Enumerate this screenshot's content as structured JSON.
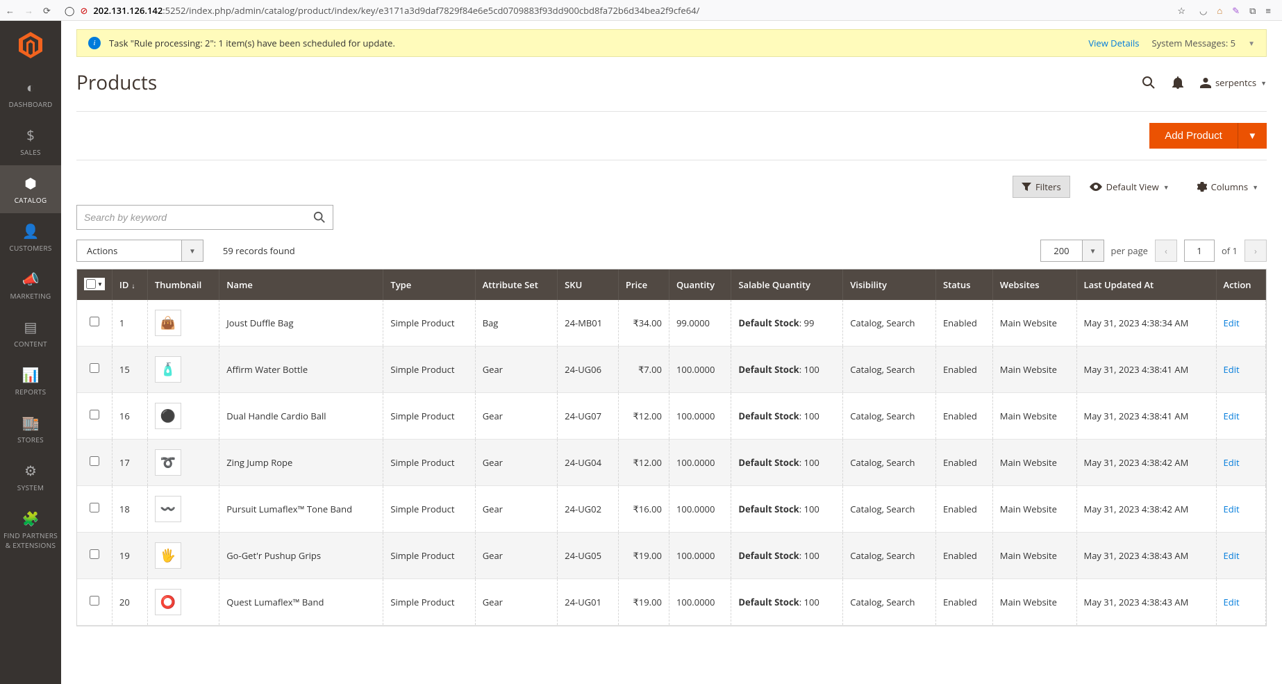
{
  "browser": {
    "url_host": "202.131.126.142",
    "url_rest": ":5252/index.php/admin/catalog/product/index/key/e3171a3d9daf7829f84e6e5cd0709883f93dd900cbd8fa72b6d34bea2f9cfe64/"
  },
  "sysmsg": {
    "text": "Task \"Rule processing: 2\": 1 item(s) have been scheduled for update.",
    "view_details": "View Details",
    "summary": "System Messages: 5"
  },
  "page": {
    "title": "Products",
    "user": "serpentcs"
  },
  "sidebar": {
    "items": [
      {
        "label": "DASHBOARD",
        "icon": "◐"
      },
      {
        "label": "SALES",
        "icon": "$"
      },
      {
        "label": "CATALOG",
        "icon": "⬢",
        "active": true
      },
      {
        "label": "CUSTOMERS",
        "icon": "👤"
      },
      {
        "label": "MARKETING",
        "icon": "📣"
      },
      {
        "label": "CONTENT",
        "icon": "▤"
      },
      {
        "label": "REPORTS",
        "icon": "📊"
      },
      {
        "label": "STORES",
        "icon": "🏬"
      },
      {
        "label": "SYSTEM",
        "icon": "⚙"
      },
      {
        "label": "FIND PARTNERS & EXTENSIONS",
        "icon": "🧩"
      }
    ]
  },
  "buttons": {
    "add_product": "Add Product",
    "filters": "Filters",
    "default_view": "Default View",
    "columns": "Columns"
  },
  "search": {
    "placeholder": "Search by keyword"
  },
  "actions": {
    "label": "Actions",
    "records_found": "59 records found",
    "page_size": "200",
    "per_page": "per page",
    "page": "1",
    "of": "of 1"
  },
  "columns": {
    "id": "ID",
    "thumb": "Thumbnail",
    "name": "Name",
    "type": "Type",
    "attrset": "Attribute Set",
    "sku": "SKU",
    "price": "Price",
    "qty": "Quantity",
    "salable": "Salable Quantity",
    "vis": "Visibility",
    "status": "Status",
    "websites": "Websites",
    "updated": "Last Updated At",
    "action": "Action"
  },
  "salable_label": "Default Stock",
  "edit_label": "Edit",
  "rows": [
    {
      "id": "1",
      "name": "Joust Duffle Bag",
      "type": "Simple Product",
      "attr": "Bag",
      "sku": "24-MB01",
      "price": "₹34.00",
      "qty": "99.0000",
      "salable": "99",
      "vis": "Catalog, Search",
      "status": "Enabled",
      "site": "Main Website",
      "updated": "May 31, 2023 4:38:34 AM"
    },
    {
      "id": "15",
      "name": "Affirm Water Bottle",
      "type": "Simple Product",
      "attr": "Gear",
      "sku": "24-UG06",
      "price": "₹7.00",
      "qty": "100.0000",
      "salable": "100",
      "vis": "Catalog, Search",
      "status": "Enabled",
      "site": "Main Website",
      "updated": "May 31, 2023 4:38:41 AM"
    },
    {
      "id": "16",
      "name": "Dual Handle Cardio Ball",
      "type": "Simple Product",
      "attr": "Gear",
      "sku": "24-UG07",
      "price": "₹12.00",
      "qty": "100.0000",
      "salable": "100",
      "vis": "Catalog, Search",
      "status": "Enabled",
      "site": "Main Website",
      "updated": "May 31, 2023 4:38:41 AM"
    },
    {
      "id": "17",
      "name": "Zing Jump Rope",
      "type": "Simple Product",
      "attr": "Gear",
      "sku": "24-UG04",
      "price": "₹12.00",
      "qty": "100.0000",
      "salable": "100",
      "vis": "Catalog, Search",
      "status": "Enabled",
      "site": "Main Website",
      "updated": "May 31, 2023 4:38:42 AM"
    },
    {
      "id": "18",
      "name": "Pursuit Lumaflex™ Tone Band",
      "type": "Simple Product",
      "attr": "Gear",
      "sku": "24-UG02",
      "price": "₹16.00",
      "qty": "100.0000",
      "salable": "100",
      "vis": "Catalog, Search",
      "status": "Enabled",
      "site": "Main Website",
      "updated": "May 31, 2023 4:38:42 AM"
    },
    {
      "id": "19",
      "name": "Go-Get'r Pushup Grips",
      "type": "Simple Product",
      "attr": "Gear",
      "sku": "24-UG05",
      "price": "₹19.00",
      "qty": "100.0000",
      "salable": "100",
      "vis": "Catalog, Search",
      "status": "Enabled",
      "site": "Main Website",
      "updated": "May 31, 2023 4:38:43 AM"
    },
    {
      "id": "20",
      "name": "Quest Lumaflex™ Band",
      "type": "Simple Product",
      "attr": "Gear",
      "sku": "24-UG01",
      "price": "₹19.00",
      "qty": "100.0000",
      "salable": "100",
      "vis": "Catalog, Search",
      "status": "Enabled",
      "site": "Main Website",
      "updated": "May 31, 2023 4:38:43 AM"
    }
  ]
}
